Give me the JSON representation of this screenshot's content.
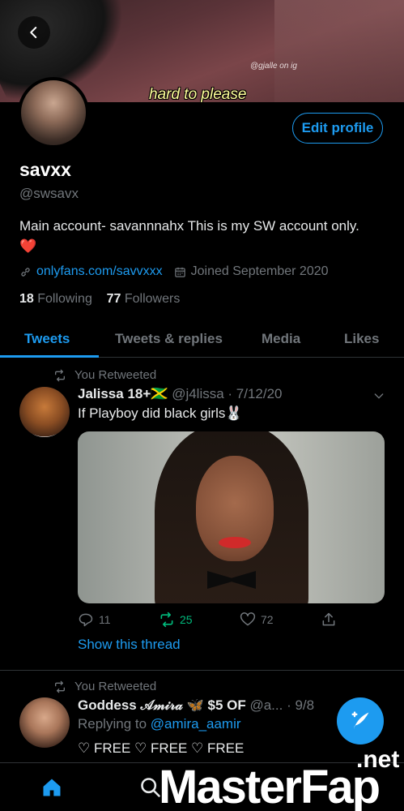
{
  "banner": {
    "watermark_tag": "@gjalle on ig",
    "caption": "hard to please"
  },
  "profile": {
    "edit_label": "Edit profile",
    "display_name": "savxx",
    "handle": "@swsavx",
    "bio": "Main account- savannnahx This is my SW account only.",
    "bio_emoji": "❤️",
    "link": "onlyfans.com/savvxxx",
    "joined": "Joined September 2020",
    "following_count": "18",
    "following_label": "Following",
    "followers_count": "77",
    "followers_label": "Followers"
  },
  "tabs": [
    {
      "label": "Tweets",
      "active": true
    },
    {
      "label": "Tweets & replies",
      "active": false
    },
    {
      "label": "Media",
      "active": false
    },
    {
      "label": "Likes",
      "active": false
    }
  ],
  "tweets": [
    {
      "rt_label": "You Retweeted",
      "name": "Jalissa 18+🇯🇲",
      "handle_time": "@j4lissa · 7/12/20",
      "text": "If Playboy did black girls🐰",
      "replies": "11",
      "retweets": "25",
      "likes": "72",
      "show_thread": "Show this thread"
    },
    {
      "rt_label": "You Retweeted",
      "name": "Goddess 𝒜𝓂𝒾𝓇𝒶 🦋 $5 OF",
      "handle_time": "@a... · 9/8",
      "reply_prefix": "Replying to",
      "reply_handle": "@amira_aamir",
      "text": "♡ FREE ♡ FREE ♡ FREE"
    }
  ],
  "watermark": {
    "main": "MasterFap",
    "suffix": ".net"
  },
  "colors": {
    "accent": "#1d9bf0",
    "retweet_green": "#00ba7c",
    "background": "#000000",
    "muted": "#71767b"
  },
  "icons": [
    "back-arrow-icon",
    "link-icon",
    "calendar-icon",
    "retweet-icon",
    "chevron-down-icon",
    "reply-icon",
    "like-icon",
    "share-icon",
    "compose-icon",
    "home-icon",
    "search-icon"
  ]
}
